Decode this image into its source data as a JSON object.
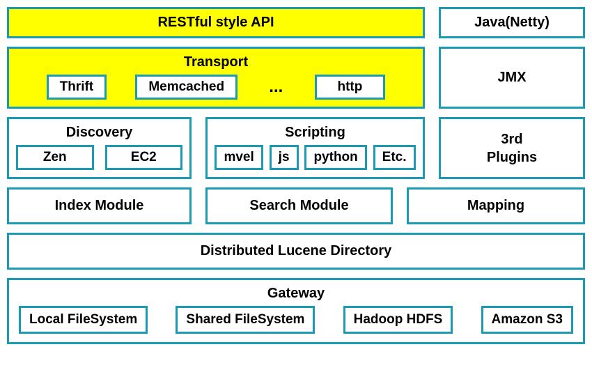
{
  "row1": {
    "api": "RESTful style API",
    "java": "Java(Netty)"
  },
  "row2": {
    "transport": {
      "title": "Transport",
      "items": [
        "Thrift",
        "Memcached",
        "http"
      ],
      "ellipsis": "..."
    },
    "jmx": "JMX"
  },
  "row3": {
    "discovery": {
      "title": "Discovery",
      "items": [
        "Zen",
        "EC2"
      ]
    },
    "scripting": {
      "title": "Scripting",
      "items": [
        "mvel",
        "js",
        "python",
        "Etc."
      ]
    },
    "plugins": "3rd\nPlugins"
  },
  "row4": {
    "index": "Index Module",
    "search": "Search Module",
    "mapping": "Mapping"
  },
  "row5": {
    "lucene": "Distributed Lucene Directory"
  },
  "row6": {
    "gateway": {
      "title": "Gateway",
      "items": [
        "Local FileSystem",
        "Shared FileSystem",
        "Hadoop HDFS",
        "Amazon S3"
      ]
    }
  }
}
